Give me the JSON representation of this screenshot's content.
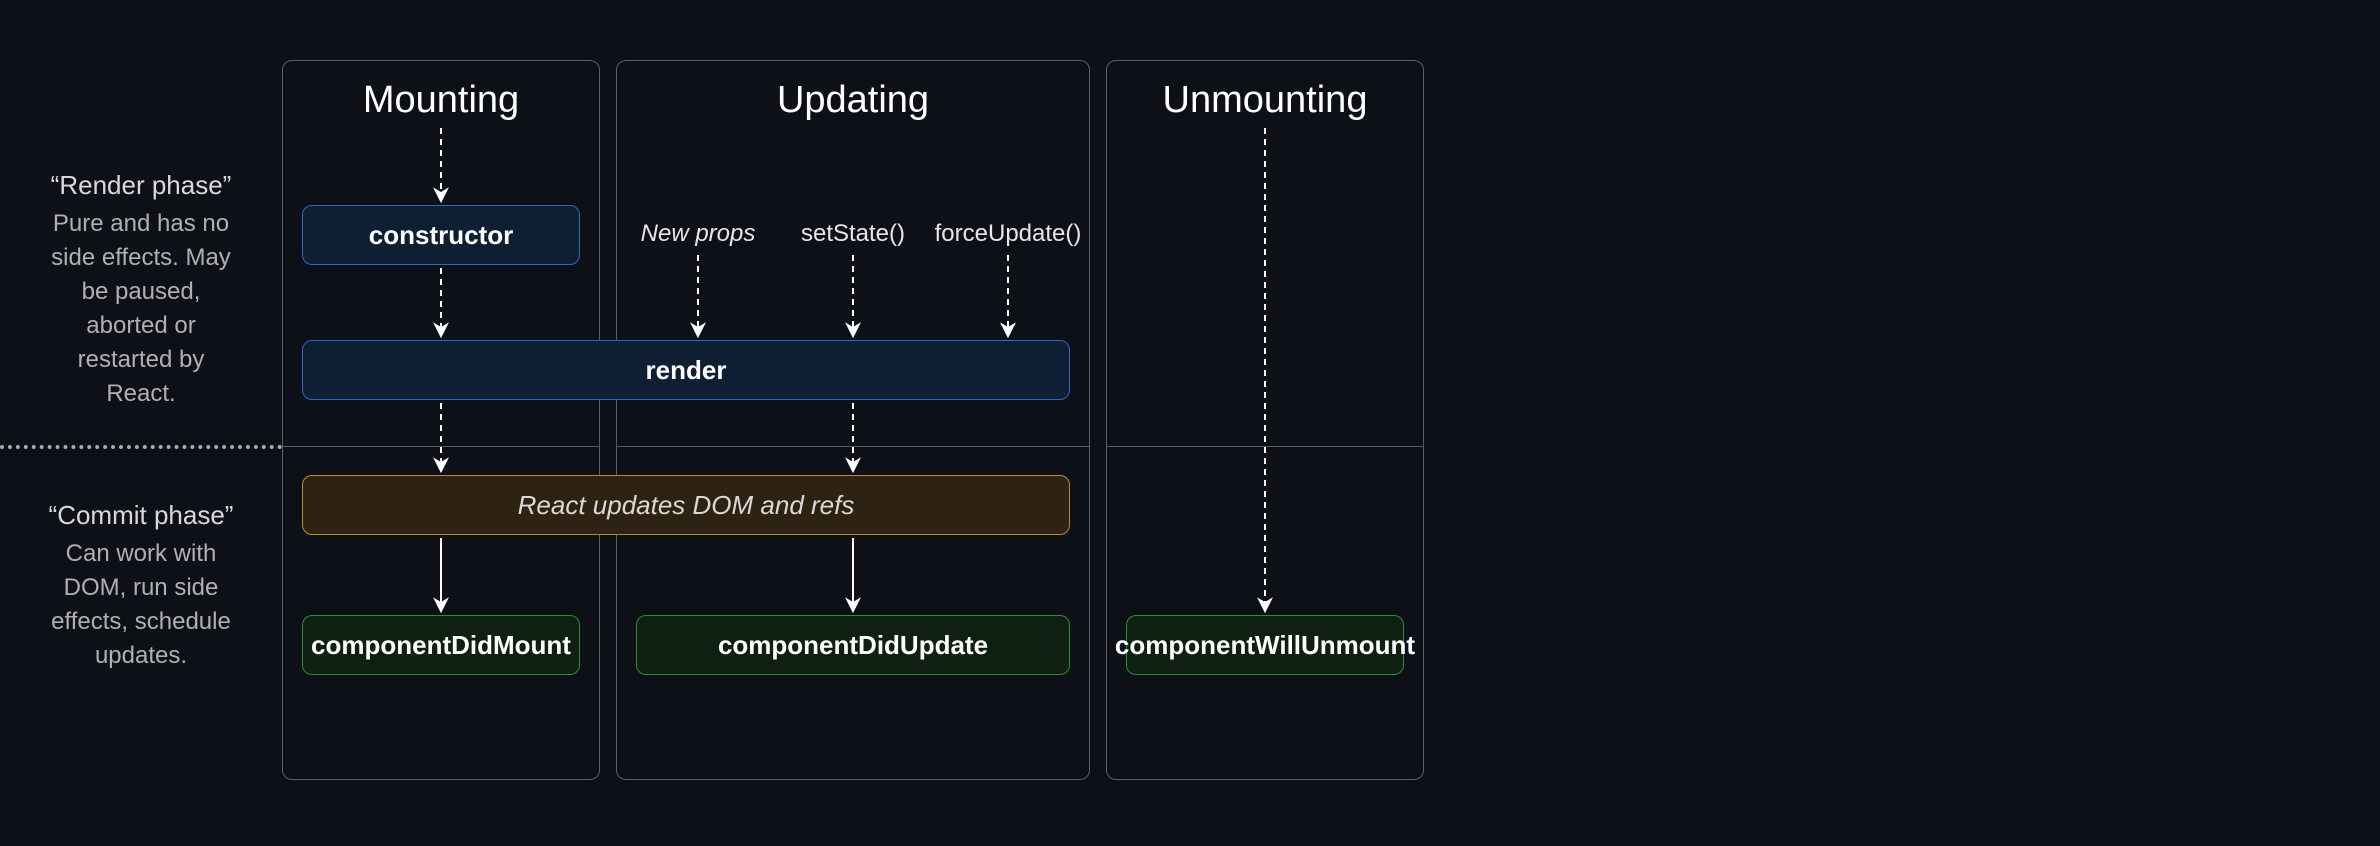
{
  "phases": {
    "render": {
      "title": "“Render phase”",
      "desc": "Pure and has no side effects. May be paused, aborted or restarted by React."
    },
    "commit": {
      "title": "“Commit phase”",
      "desc": "Can work with DOM, run side effects, schedule updates."
    }
  },
  "columns": {
    "mounting": "Mounting",
    "updating": "Updating",
    "unmounting": "Unmounting"
  },
  "boxes": {
    "constructor": "constructor",
    "render": "render",
    "dom_update": "React updates DOM and refs",
    "did_mount": "componentDidMount",
    "did_update": "componentDidUpdate",
    "will_unmount": "componentWillUnmount"
  },
  "triggers": {
    "new_props": "New props",
    "set_state": "setState()",
    "force_update": "forceUpdate()"
  }
}
